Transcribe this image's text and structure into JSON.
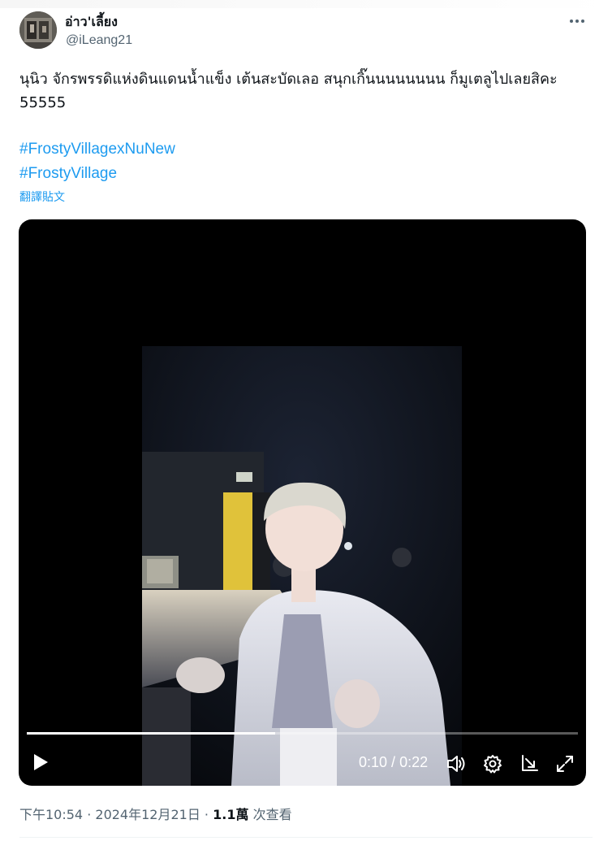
{
  "author": {
    "display_name": "อ่าว'เลี้ยง",
    "handle": "@iLeang21"
  },
  "tweet": {
    "text": "นุนิว จักรพรรดิแห่งดินแดนน้ำแข็ง เต้นสะบัดเลอ สนุกเกิ๊นนนนนนนน ก็มูเตลูไปเลยสิคะ 55555",
    "hashtags": [
      "#FrostyVillagexNuNew",
      "#FrostyVillage"
    ],
    "translate_label": "翻譯貼文"
  },
  "video": {
    "current_time": "0:10",
    "duration": "0:22",
    "time_separator": " / ",
    "progress_fraction": 0.45
  },
  "meta": {
    "time": "下午10:54",
    "date": "2024年12月21日",
    "separator": " · ",
    "views_count": "1.1萬",
    "views_label": "次查看"
  },
  "icons": {
    "more": "more-horizontal-icon",
    "play": "play-icon",
    "volume": "volume-icon",
    "settings": "settings-gear-icon",
    "popout": "pop-out-icon",
    "fullscreen": "fullscreen-icon"
  },
  "colors": {
    "link": "#1d9bf0",
    "secondary_text": "#536471",
    "primary_text": "#0f1419",
    "video_bg": "#000000"
  }
}
